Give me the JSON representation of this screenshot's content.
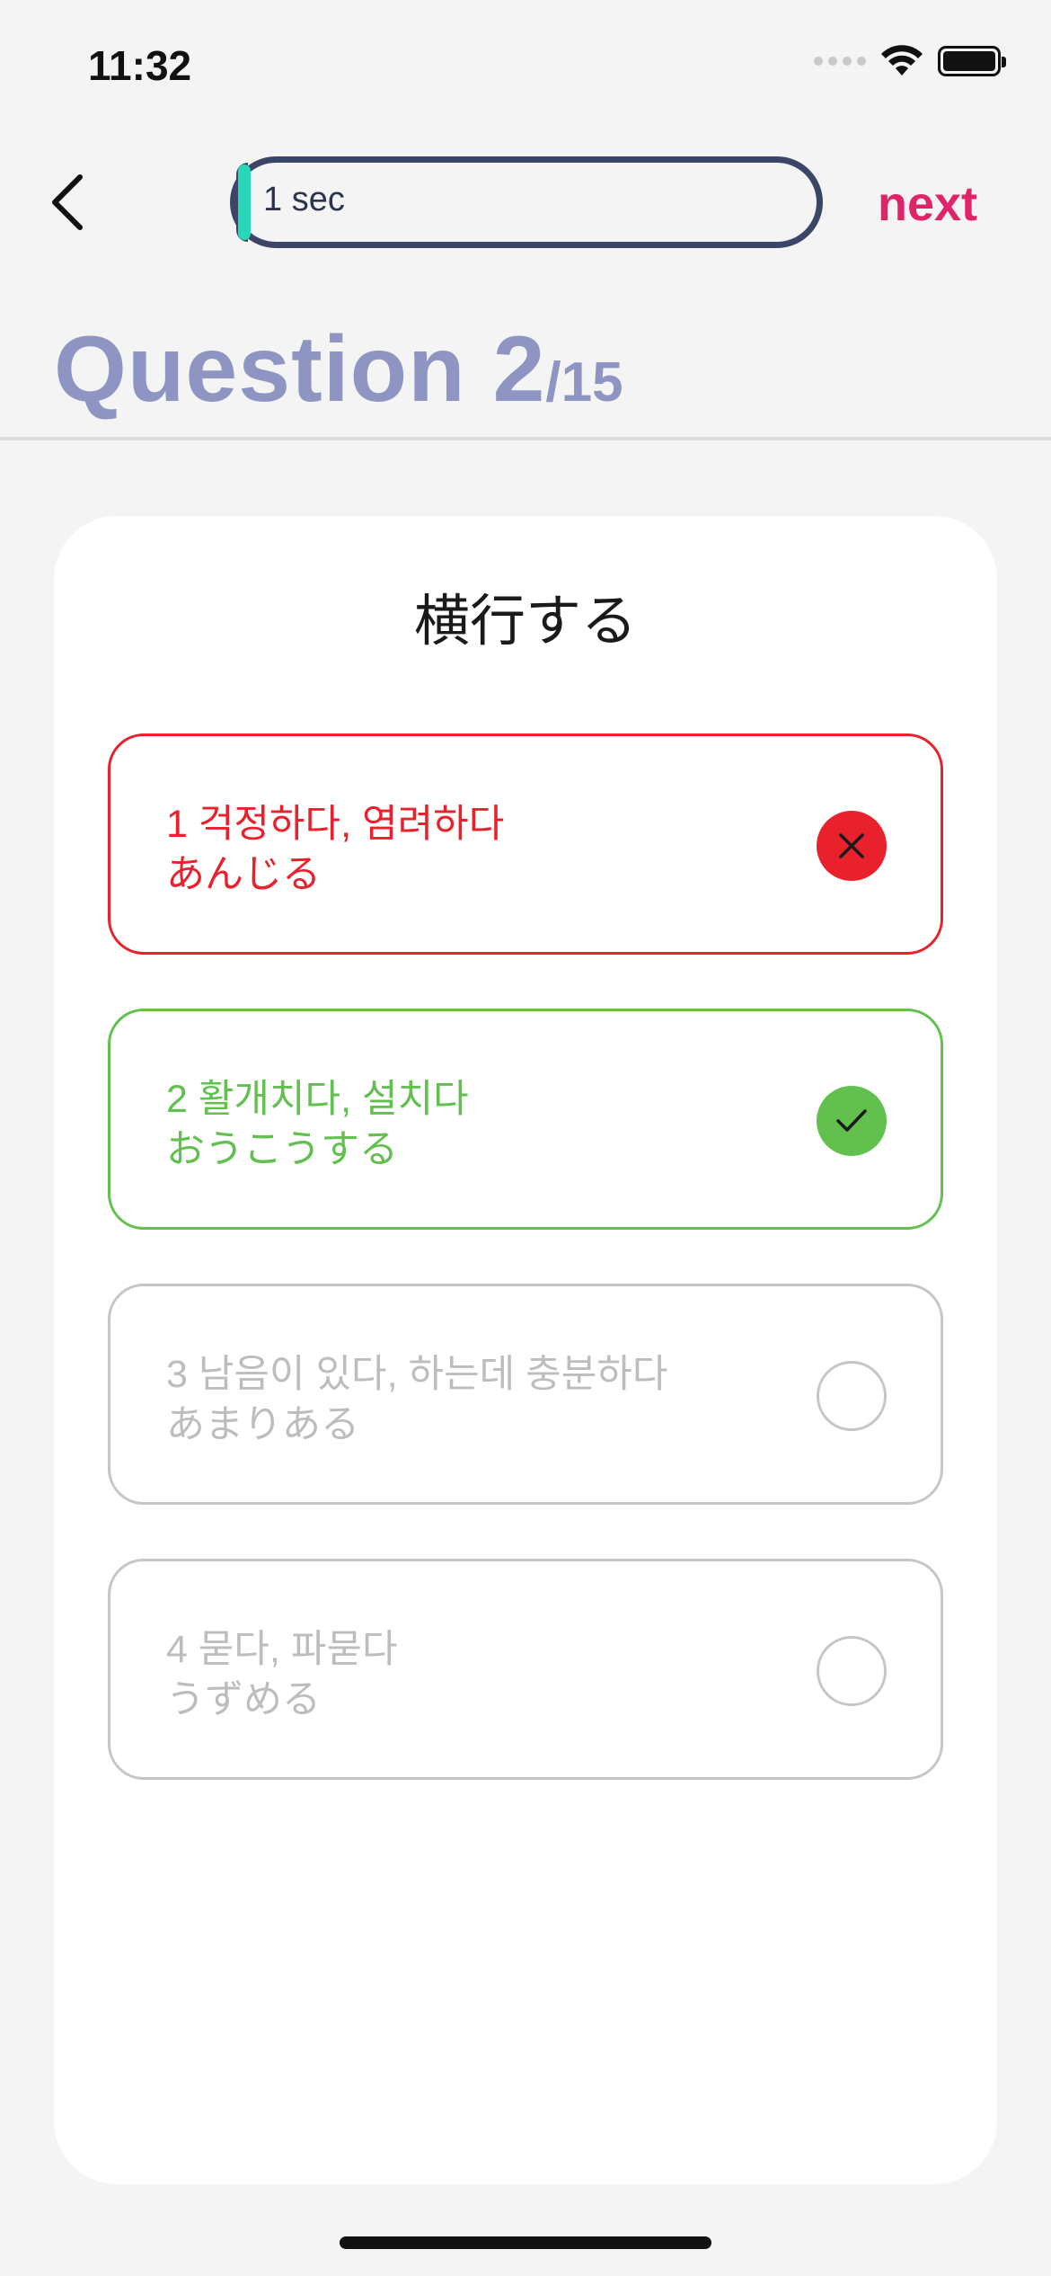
{
  "status_bar": {
    "time": "11:32"
  },
  "nav": {
    "timer_text": "1 sec",
    "timer_progress": 0.02,
    "next_label": "next",
    "colors": {
      "track": "#3b4568",
      "cap": "#2ad6b8",
      "next": "#e0246a"
    }
  },
  "question": {
    "label": "Question 2",
    "total": "/15",
    "prompt": "横行する"
  },
  "options": [
    {
      "number": "1",
      "korean": "걱정하다, 염려하다",
      "japanese": "あんじる",
      "state": "wrong"
    },
    {
      "number": "2",
      "korean": "활개치다, 설치다",
      "japanese": "おうこうする",
      "state": "correct"
    },
    {
      "number": "3",
      "korean": "남음이 있다, 하는데 충분하다",
      "japanese": "あまりある",
      "state": "unselected"
    },
    {
      "number": "4",
      "korean": "묻다, 파묻다",
      "japanese": "うずめる",
      "state": "unselected"
    }
  ],
  "state_colors": {
    "wrong": "#e8212c",
    "correct": "#62c04e",
    "unselected": "#bdbdbd"
  },
  "icons": {
    "back": "chevron-left-icon",
    "wrong": "close-icon",
    "correct": "check-icon"
  }
}
